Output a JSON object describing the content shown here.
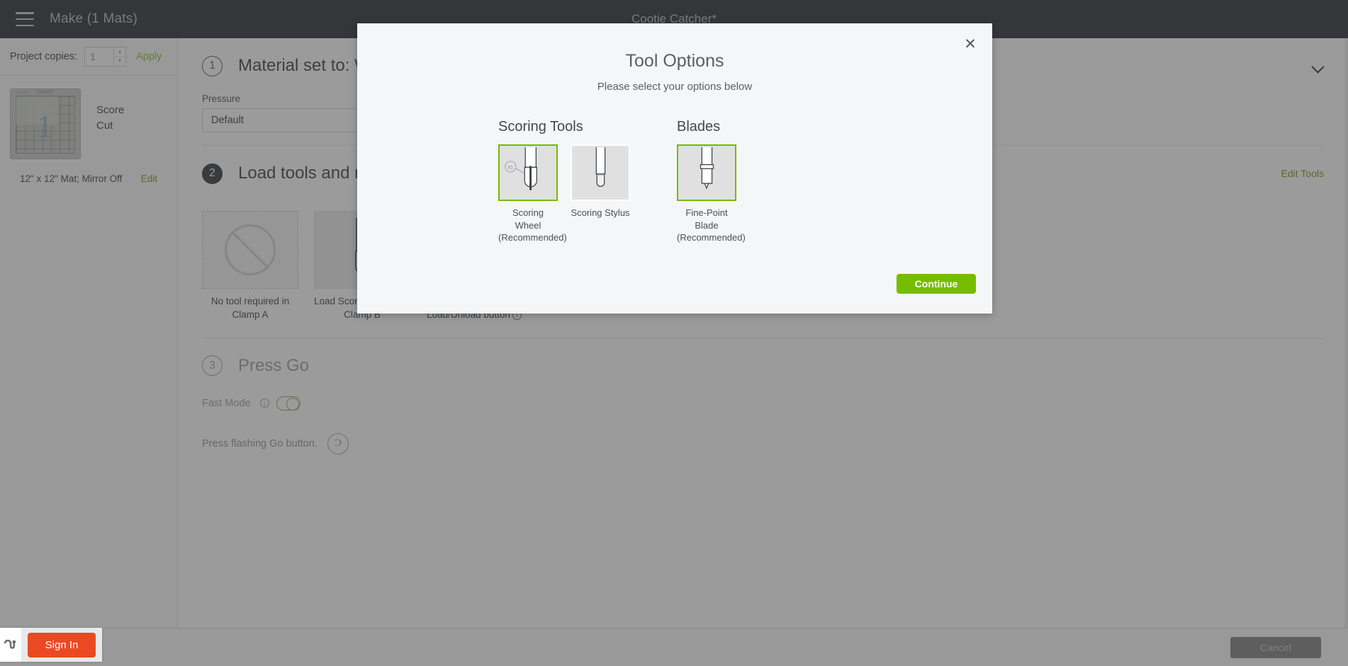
{
  "topbar": {
    "menu_icon": "hamburger-icon",
    "title": "Make (1 Mats)",
    "doc_title": "Cootie Catcher*"
  },
  "sidebar": {
    "copies_label": "Project copies:",
    "copies_value": "1",
    "copies_placeholder": "1",
    "apply_label": "Apply",
    "mat": {
      "logo": "Cricut",
      "number": "1",
      "operations": [
        "Score",
        "Cut"
      ],
      "meta": "12\" x 12\" Mat; Mirror Off",
      "edit_label": "Edit"
    }
  },
  "steps": [
    {
      "number": "1",
      "title": "Material set to: W",
      "pressure_label": "Pressure",
      "pressure_value": "Default",
      "chevron_icon": "chevron-down-icon"
    },
    {
      "number": "2",
      "title": "Load tools and m",
      "edit_tools_label": "Edit Tools",
      "cards": [
        {
          "icon": "no-tool-icon",
          "caption": "No tool required in Clamp A"
        },
        {
          "icon": "scoring-wheel-icon",
          "caption": "Load Scoring Wheel in Clamp B"
        },
        {
          "icon": "mat-load-icon",
          "caption": "Load mat and press Load/Unload button",
          "info_icon": "info-icon"
        }
      ]
    },
    {
      "number": "3",
      "title": "Press Go",
      "fast_mode_label": "Fast Mode",
      "fast_mode_info_icon": "info-icon",
      "fast_mode_on": false,
      "go_text": "Press flashing Go button.",
      "go_icon": "cricut-go-icon"
    }
  ],
  "footer": {
    "cancel_label": "Cancel"
  },
  "signin": {
    "widget_icon": "stumbleupon-icon",
    "button_label": "Sign In"
  },
  "modal": {
    "close_icon": "close-icon",
    "title": "Tool Options",
    "subtitle": "Please select your options below",
    "groups": [
      {
        "title": "Scoring Tools",
        "tools": [
          {
            "name": "scoring-wheel",
            "icon": "scoring-wheel-icon",
            "badge": "01",
            "caption": "Scoring Wheel (Recommended)",
            "selected": true
          },
          {
            "name": "scoring-stylus",
            "icon": "scoring-stylus-icon",
            "badge": "",
            "caption": "Scoring Stylus",
            "selected": false
          }
        ]
      },
      {
        "title": "Blades",
        "tools": [
          {
            "name": "fine-point-blade",
            "icon": "fine-point-blade-icon",
            "badge": "",
            "caption": "Fine-Point Blade (Recommended)",
            "selected": true
          }
        ]
      }
    ],
    "continue_label": "Continue"
  },
  "colors": {
    "accent_green": "#76bc00",
    "link_green": "#6f9a13",
    "signin_red": "#eb4924",
    "topbar_dark": "#282d33"
  }
}
